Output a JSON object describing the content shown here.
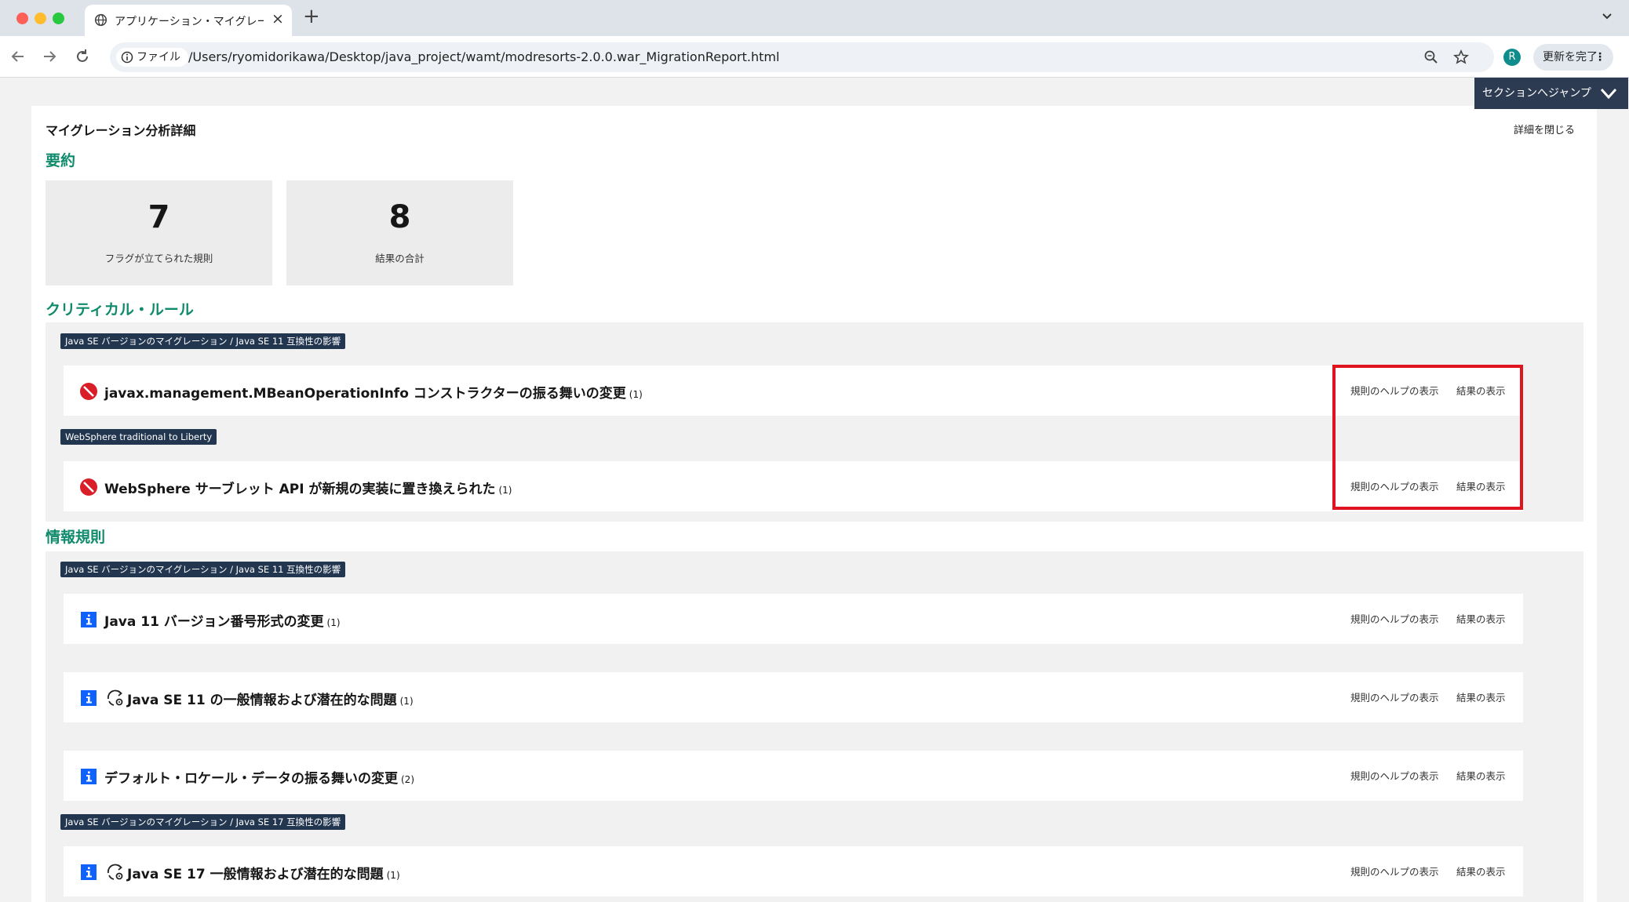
{
  "browser": {
    "tab_title": "アプリケーション・マイグレーション",
    "tab_close": "×",
    "new_tab": "+",
    "url_scheme_label": "ファイル",
    "url": "/Users/ryomidorikawa/Desktop/java_project/wamt/modresorts-2.0.0.war_MigrationReport.html",
    "avatar_letter": "R",
    "update_label": "更新を完了",
    "update_menu": "⋮"
  },
  "header": {
    "jump_label": "セクションへジャンプ",
    "title": "マイグレーション分析詳細",
    "close_details": "詳細を閉じる"
  },
  "summary": {
    "heading": "要約",
    "cards": [
      {
        "value": "7",
        "label": "フラグが立てられた規則"
      },
      {
        "value": "8",
        "label": "結果の合計"
      }
    ]
  },
  "critical": {
    "heading": "クリティカル・ルール",
    "tags": [
      "Java SE バージョンのマイグレーション / Java SE 11 互換性の影響",
      "WebSphere traditional to Liberty"
    ],
    "rows": [
      {
        "title": "javax.management.MBeanOperationInfo コンストラクターの振る舞いの変更",
        "count": "(1)",
        "help": "規則のヘルプの表示",
        "results": "結果の表示"
      },
      {
        "title": "WebSphere サーブレット API が新規の実装に置き換えられた",
        "count": "(1)",
        "help": "規則のヘルプの表示",
        "results": "結果の表示"
      }
    ]
  },
  "info": {
    "heading": "情報規則",
    "tags": [
      "Java SE バージョンのマイグレーション / Java SE 11 互換性の影響",
      "Java SE バージョンのマイグレーション / Java SE 17 互換性の影響"
    ],
    "rows": [
      {
        "title": "Java 11 バージョン番号形式の変更",
        "count": "(1)",
        "help": "規則のヘルプの表示",
        "results": "結果の表示"
      },
      {
        "title": "Java SE 11 の一般情報および潜在的な問題",
        "count": "(1)",
        "help": "規則のヘルプの表示",
        "results": "結果の表示"
      },
      {
        "title": "デフォルト・ロケール・データの振る舞いの変更",
        "count": "(2)",
        "help": "規則のヘルプの表示",
        "results": "結果の表示"
      },
      {
        "title": "Java SE 17 一般情報および潜在的な問題",
        "count": "(1)",
        "help": "規則のヘルプの表示",
        "results": "結果の表示"
      }
    ]
  },
  "icons": {
    "critical": "prohibited-icon",
    "info": "info-icon",
    "general": "cycle-gear-icon"
  },
  "colors": {
    "section_heading": "#0f8a6c",
    "tag_bg": "#233650",
    "critical_icon": "#da1e28",
    "info_icon": "#0f62fe",
    "highlight_box": "#e0141e",
    "jump_button": "#2d3b52"
  }
}
